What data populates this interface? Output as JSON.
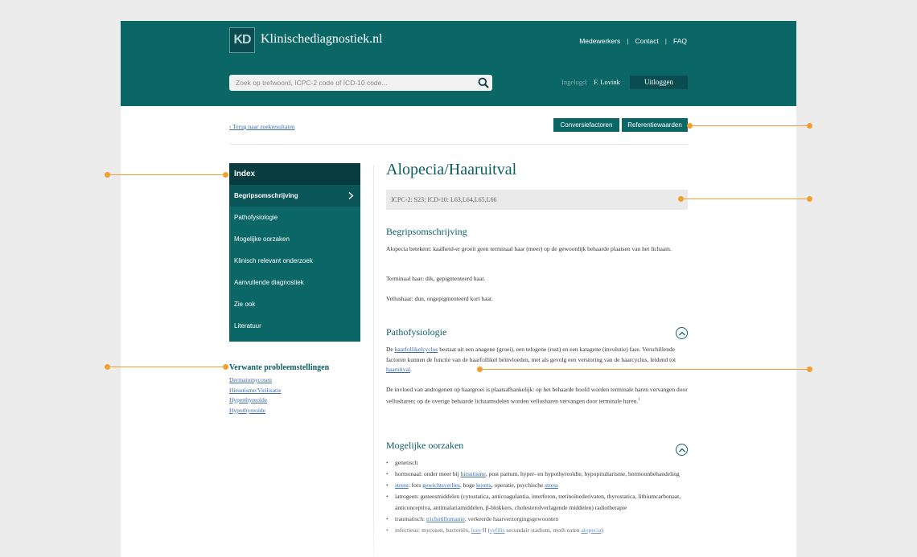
{
  "header": {
    "logo_mark": "KD",
    "site_name": "Klinischediagnostiek.nl",
    "nav": [
      "Medewerkers",
      "Contact",
      "FAQ"
    ],
    "nav_sep": "|",
    "search_placeholder": "Zoek op trefwoord, ICPC-2 code of ICD-10 code...",
    "login_label": "Ingelogd:",
    "login_user": "F. Lovink",
    "logout_label": "Uitloggen"
  },
  "toolbar": {
    "back_link": "‹ Terug naar zoekresultaten",
    "btn_conversion": "Conversiefactoren",
    "btn_reference": "Referentiewaarden"
  },
  "index": {
    "title": "Index",
    "items": [
      "Begripsomschrijving",
      "Pathofysiologie",
      "Mogelijke oorzaken",
      "Klinisch relevant onderzoek",
      "Aanvullende diagnostiek",
      "Zie ook",
      "Literatuur"
    ]
  },
  "related": {
    "title": "Verwante probleemstellingen",
    "items": [
      "Dermatomycosen",
      "Hirsutisme/Virilisatie",
      "Hyperthyreoïde",
      "Hypothyreoïde"
    ]
  },
  "article": {
    "title": "Alopecia/Haaruitval",
    "codes": "ICPC-2: S23; ICD-10: L63,L64,L65,L66",
    "s1": {
      "title": "Begripsomschrijving",
      "p1": "Alopecia betekent: kaalheid-er groeit geen terminaal haar (meer) op de gewoonlijk behaarde plaatsen van het lichaam.",
      "p2": "Terminaal haar: dik, gepigmenteerd haar.",
      "p3": "Vellushaar: dun, ongepigmenteerd kort haar."
    },
    "s2": {
      "title": "Pathofysiologie",
      "p1_a": "De ",
      "p1_link": "haarfollikelcyclus",
      "p1_b": " bestaat uit een anagene (groei), een telogene (rust) en een katagene (involutie) fase. Verschillende factoren kunnen de functie van de haarfollikel beïnvloeden, met als gevolg een verstoring van de haarcyclus, leidend tot ",
      "p1_link2": "haaruitval",
      "p1_c": ".",
      "p2": "De invloed van androgenen op haargroei is plaatsafhankelijk: op het behaarde hoofd worden terminale haren vervangen door vellusharen; op de overige behaarde lichaamsdelen worden vellusharen vervangen door terminale haren.",
      "p2_sup": "1"
    },
    "s3": {
      "title": "Mogelijke oorzaken",
      "c1": "genetisch",
      "c2_a": "hormonaal: onder meer bij ",
      "c2_link": "hirsutisme",
      "c2_b": ", post partum, hyper- en hypothyreoïdie, hypopituïtarisme, hormoonbehandeling",
      "c3_link1": "stress",
      "c3_a": ": fors ",
      "c3_link2": "gewichtsverlies",
      "c3_b": ", hoge ",
      "c3_link3": "koorts",
      "c3_c": ", operatie, psychische ",
      "c3_link4": "stress",
      "c4": "iatrogeen: geneesmiddelen (cytostatica, anticoagulantia, interferon, tretinoïnederivaten, thyrostatica, lithiumcarbonaat, anticonceptiva, antimalariamiddelen, β-blokkers, cholesterolverlagende middelen) radiotherapie",
      "c5_a": "traumatisch: ",
      "c5_link": "trichotillomanie",
      "c5_b": ", verkeerde haarverzorgingsgewoonten",
      "c6_a": "infectieus: mycosen, bacteriën, ",
      "c6_link1": "lues",
      "c6_b": " II (",
      "c6_link2": "syfilis",
      "c6_c": " secundair stadium, moth eaten ",
      "c6_link3": "alopecia",
      "c6_d": ")"
    }
  },
  "colors": {
    "teal": "#0b6666",
    "teal_dark": "#073d40",
    "accent": "#f0a030",
    "link": "#3a6aa8"
  }
}
